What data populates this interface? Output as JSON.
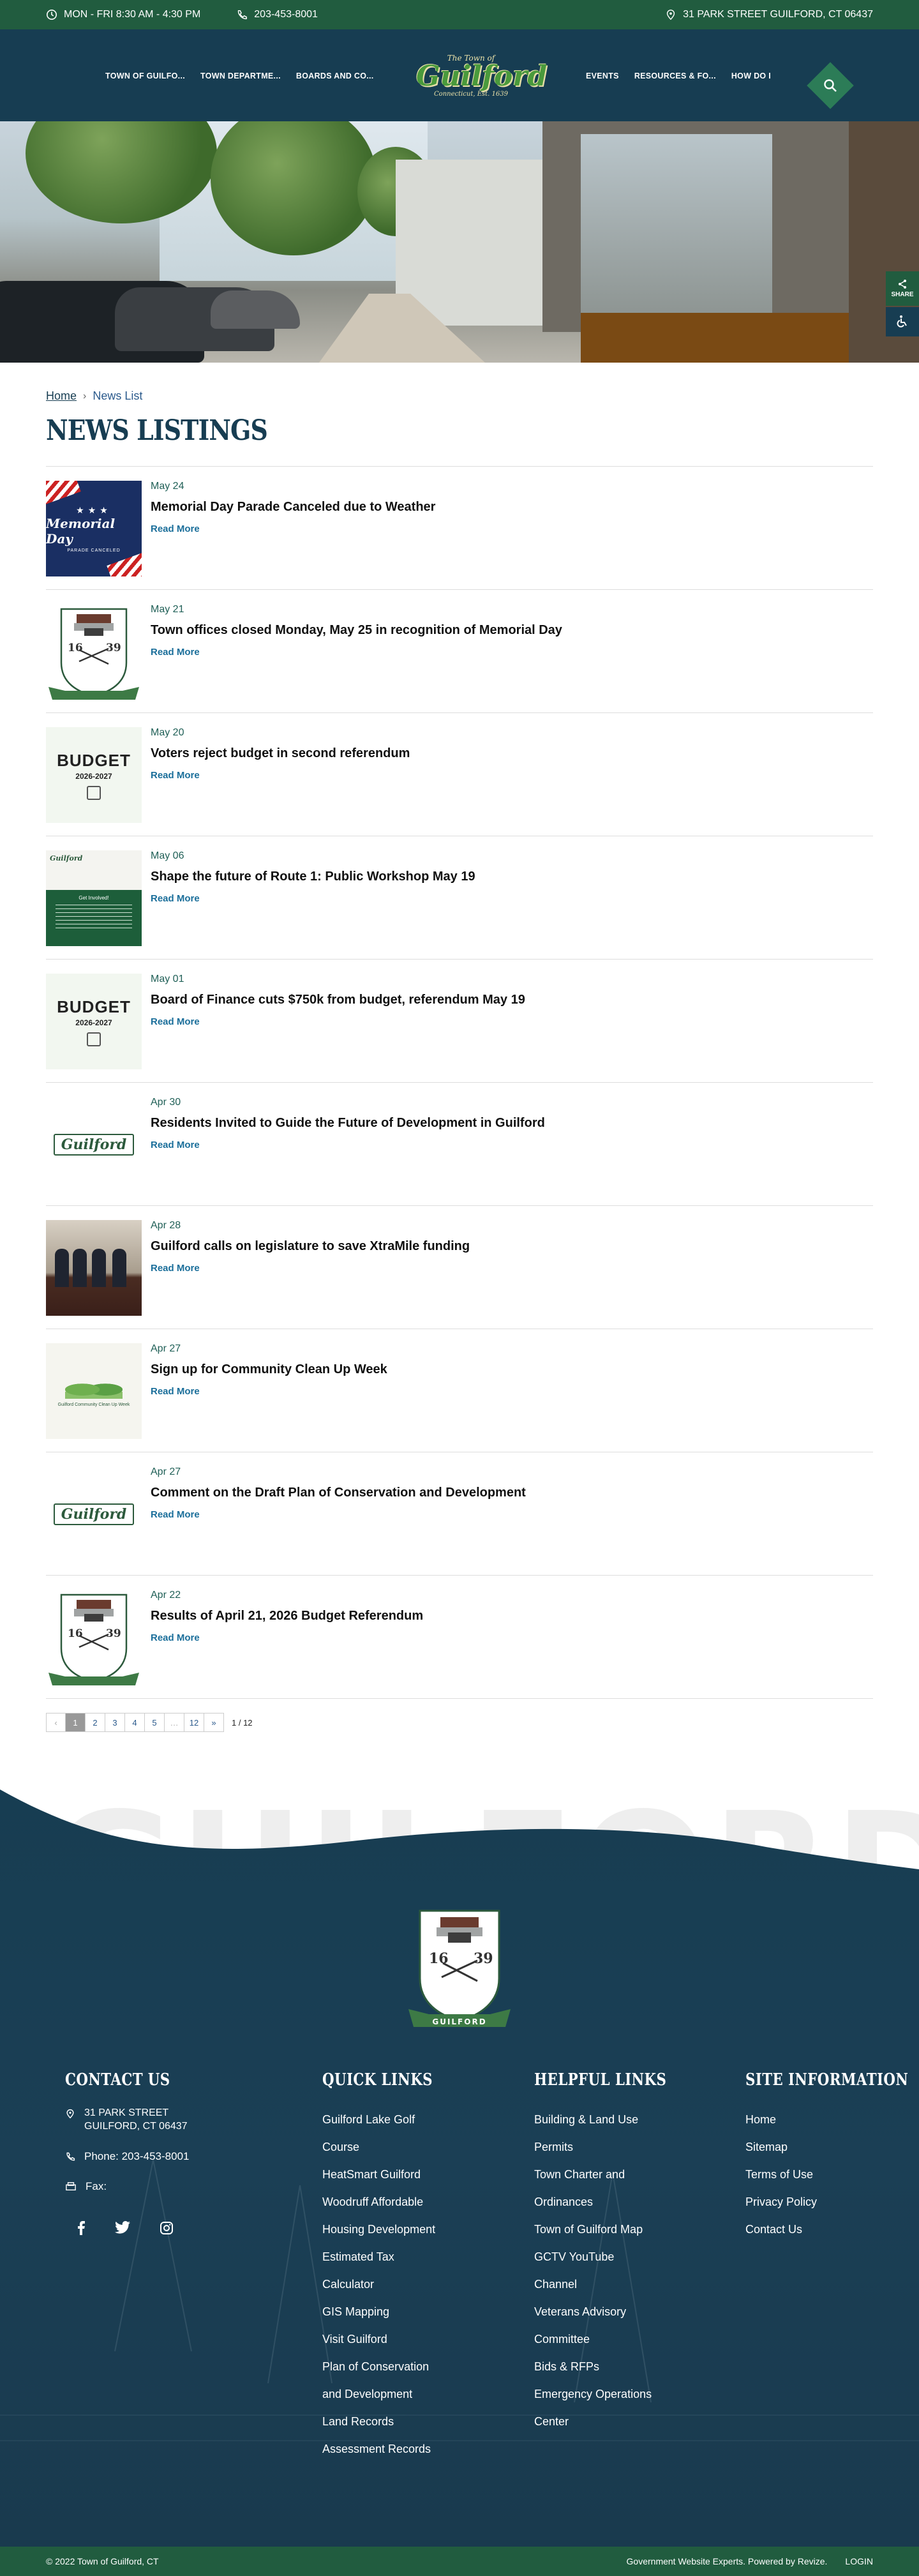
{
  "topbar": {
    "hours": "MON - FRI 8:30 AM - 4:30 PM",
    "phone": "203-453-8001",
    "address": "31 PARK STREET GUILFORD, CT 06437"
  },
  "header": {
    "nav_left": [
      "TOWN OF GUILFO...",
      "TOWN DEPARTME...",
      "BOARDS AND CO..."
    ],
    "nav_right": [
      "EVENTS",
      "RESOURCES & FO...",
      "HOW DO I"
    ],
    "logo_top": "The Town of",
    "logo_name": "Guilford",
    "logo_sub": "Connecticut, Est. 1639"
  },
  "share": {
    "label": "SHARE"
  },
  "breadcrumb": {
    "home": "Home",
    "current": "News List"
  },
  "page_title": "NEWS LISTINGS",
  "news": [
    {
      "date": "May 24",
      "title": "Memorial Day Parade Canceled due to Weather",
      "more": "Read More",
      "thumb": "memorial"
    },
    {
      "date": "May 21",
      "title": "Town offices closed Monday, May 25 in recognition of Memorial Day",
      "more": "Read More",
      "thumb": "seal"
    },
    {
      "date": "May 20",
      "title": "Voters reject budget in second referendum",
      "more": "Read More",
      "thumb": "budget"
    },
    {
      "date": "May 06",
      "title": "Shape the future of Route 1: Public Workshop May 19",
      "more": "Read More",
      "thumb": "route"
    },
    {
      "date": "May 01",
      "title": "Board of Finance cuts $750k from budget, referendum May 19",
      "more": "Read More",
      "thumb": "budget"
    },
    {
      "date": "Apr 30",
      "title": "Residents Invited to Guide the Future of Development in Guilford",
      "more": "Read More",
      "thumb": "guilford"
    },
    {
      "date": "Apr 28",
      "title": "Guilford calls on legislature to save XtraMile funding",
      "more": "Read More",
      "thumb": "photo"
    },
    {
      "date": "Apr 27",
      "title": "Sign up for Community Clean Up Week",
      "more": "Read More",
      "thumb": "clean"
    },
    {
      "date": "Apr 27",
      "title": "Comment on the Draft Plan of Conservation and Development",
      "more": "Read More",
      "thumb": "guilford"
    },
    {
      "date": "Apr 22",
      "title": "Results of April 21, 2026 Budget Referendum",
      "more": "Read More",
      "thumb": "seal"
    }
  ],
  "thumb_text": {
    "memorial_title": "Memorial Day",
    "memorial_sub": "PARADE CANCELED",
    "budget_title": "BUDGET",
    "budget_years": "2026-2027",
    "route_head": "Guilford",
    "route_mid": "Get Involved!",
    "guilford_word": "Guilford",
    "clean_text": "Guilford Community Clean Up Week"
  },
  "pager": {
    "prev": "‹",
    "pages": [
      "1",
      "2",
      "3",
      "4",
      "5",
      "…",
      "12"
    ],
    "next": "»",
    "active": "1",
    "count": "1 / 12"
  },
  "footer": {
    "watermark": "GUILFORD",
    "seal_banner": "GUILFORD",
    "seal_left": "16",
    "seal_right": "39",
    "contact": {
      "heading": "CONTACT US",
      "address1": "31 PARK STREET",
      "address2": "GUILFORD, CT 06437",
      "phone": "Phone: 203-453-8001",
      "fax": "Fax:"
    },
    "quick": {
      "heading": "QUICK LINKS",
      "items": [
        "Guilford Lake Golf",
        "Course",
        "HeatSmart Guilford",
        "Woodruff Affordable",
        "Housing Development",
        "Estimated Tax",
        "Calculator",
        "GIS Mapping",
        "Visit Guilford",
        "Plan of Conservation",
        "and Development",
        "Land Records",
        "Assessment Records"
      ]
    },
    "helpful": {
      "heading": "HELPFUL LINKS",
      "items": [
        "Building & Land Use",
        "Permits",
        "Town Charter and",
        "Ordinances",
        "Town of Guilford Map",
        "GCTV YouTube",
        "Channel",
        "Veterans Advisory",
        "Committee",
        "Bids & RFPs",
        "Emergency Operations",
        "Center"
      ]
    },
    "site": {
      "heading": "SITE INFORMATION",
      "items": [
        "Home",
        "Sitemap",
        "Terms of Use",
        "Privacy Policy",
        "Contact Us"
      ]
    }
  },
  "bottombar": {
    "copyright": "© 2022 Town of Guilford, CT",
    "powered": "Government Website Experts. Powered by Revize.",
    "login": "LOGIN"
  },
  "colors": {
    "green": "#215c3f",
    "navy": "#173d52",
    "link": "#1a6e9a"
  }
}
